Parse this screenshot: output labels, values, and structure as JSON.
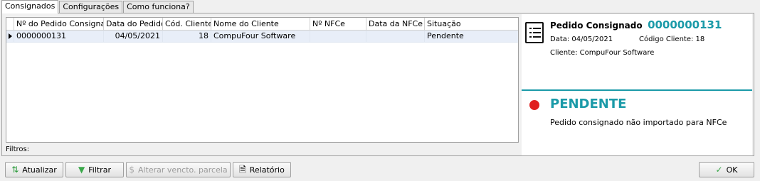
{
  "tabs": [
    {
      "label": "Consignados"
    },
    {
      "label": "Configurações"
    },
    {
      "label": "Como funciona?"
    }
  ],
  "grid": {
    "columns": [
      "Nº do Pedido Consignado",
      "Data do Pedido",
      "Cód. Cliente",
      "Nome do Cliente",
      "Nº NFCe",
      "Data da NFCe",
      "Situação"
    ],
    "rows": [
      {
        "pedido": "0000000131",
        "data": "04/05/2021",
        "cod": "18",
        "nome": "CompuFour Software",
        "nfce": "",
        "data_nfce": "",
        "situacao": "Pendente"
      }
    ]
  },
  "detail": {
    "title_label": "Pedido Consignado",
    "pedido_number": "0000000131",
    "data_line": "Data: 04/05/2021",
    "codigo_line": "Código Cliente: 18",
    "cliente_line": "Cliente: CompuFour Software",
    "status": "PENDENTE",
    "status_desc": "Pedido consignado não importado para NFCe",
    "accent_color": "#1a9aa8",
    "status_color": "#e02020"
  },
  "filters_label": "Filtros:",
  "toolbar": {
    "atualizar": "Atualizar",
    "filtrar": "Filtrar",
    "alterar": "Alterar vencto. parcela",
    "relatorio": "Relatório",
    "ok": "OK"
  }
}
